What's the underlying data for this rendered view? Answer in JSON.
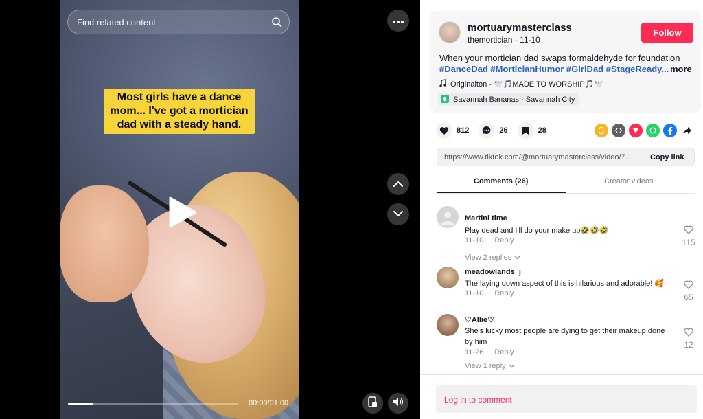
{
  "video": {
    "search_placeholder": "Find related content",
    "caption": "Most girls have a dance mom... I've got a mortician dad with a steady hand.",
    "progress_fraction": 0.15,
    "time": "00:09/01:00"
  },
  "post": {
    "username": "mortuarymasterclass",
    "nickname": "themortician",
    "date": "11-10",
    "follow_label": "Follow",
    "description": "When your mortician dad swaps formaldehyde for foundation",
    "hashtags": "#DanceDad #MorticianHumor #GirlDad #StageReady...",
    "more_label": "more",
    "music": "Originalton - 🕊️🎵MADE TO WORSHIP🎵🕊️",
    "location": "Savannah Bananas · Savannah City"
  },
  "stats": {
    "likes": "812",
    "comments": "26",
    "saves": "28"
  },
  "link": {
    "url": "https://www.tiktok.com/@mortuarymasterclass/video/7...",
    "copy_label": "Copy link"
  },
  "tabs": {
    "comments": "Comments (26)",
    "creator": "Creator videos"
  },
  "comments": [
    {
      "user": "Martini time",
      "text": "Play dead and I'll do your make up🤣🤣🤣",
      "date": "11-10",
      "reply": "Reply",
      "likes": "115",
      "replies": "View 2 replies"
    },
    {
      "user": "meadowlands_j",
      "text": "The laying down aspect of this is hilarious and adorable! 🥰",
      "date": "11-10",
      "reply": "Reply",
      "likes": "65"
    },
    {
      "user": "♡Allie♡",
      "text": "She's lucky most people are dying to get their makeup done by him",
      "date": "11-26",
      "reply": "Reply",
      "likes": "12",
      "replies": "View 1 reply"
    }
  ],
  "login": {
    "label": "Log in to comment"
  },
  "colors": {
    "accent": "#fe2c55",
    "hashtag": "#2b5db9",
    "caption_bg": "#f7d43a"
  }
}
